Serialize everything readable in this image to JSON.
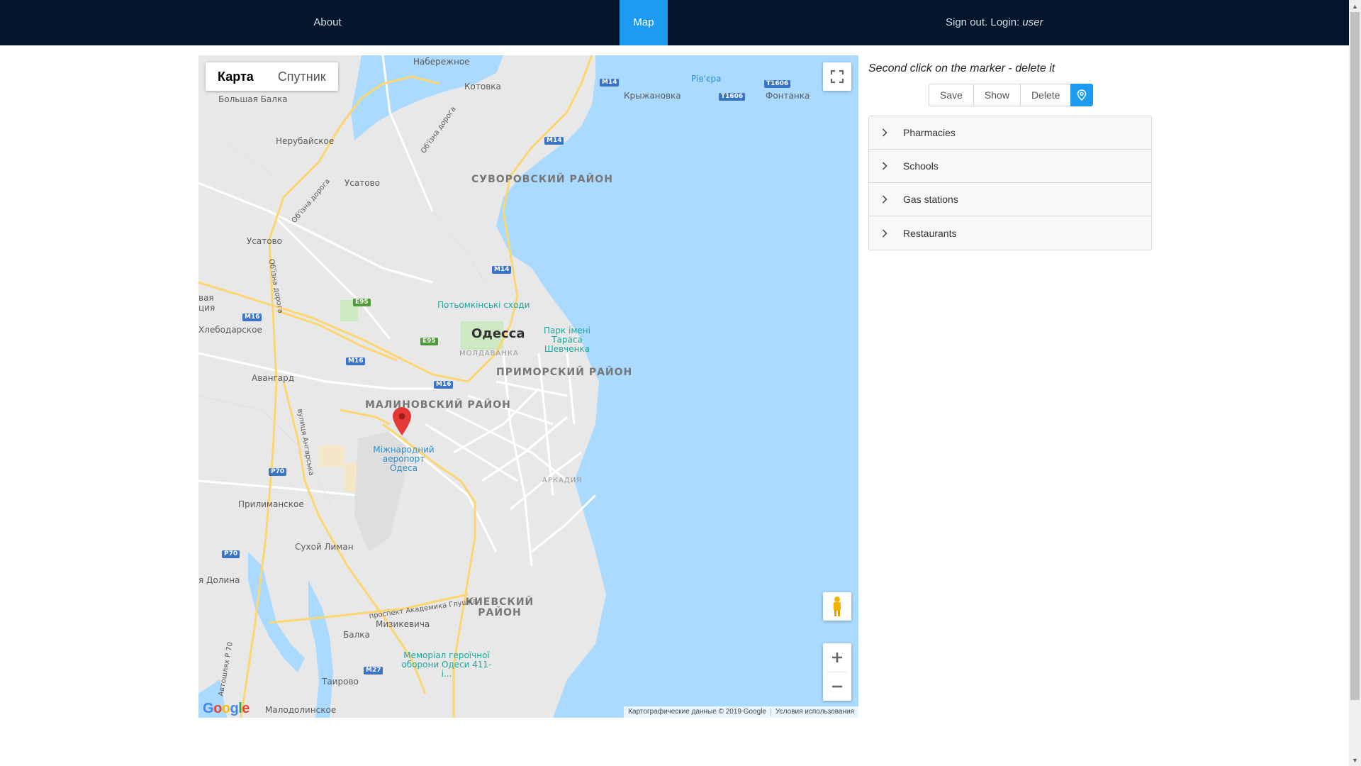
{
  "nav": {
    "about": "About",
    "map": "Map",
    "signout_prefix": "Sign out. Login:",
    "signout_user": "user"
  },
  "map": {
    "type_map": "Карта",
    "type_satellite": "Спутник",
    "attribution": "Картографические данные © 2019 Google",
    "terms": "Условия использования",
    "logo": "Google",
    "labels": {
      "naberezhnoe": "Набережное",
      "kotovka": "Котовка",
      "bolshaya_balka": "Большая Балка",
      "nerubayskoe": "Нерубайское",
      "usatovo1": "Усатово",
      "usatovo2": "Усатово",
      "suvorovsky": "СУВОРОВСКИЙ РАЙОН",
      "riviera": "Рів'єра",
      "kryzhanovka": "Крыжановка",
      "fontanka": "Фонтанка",
      "potemkin": "Потьомкінські сходи",
      "odessa": "Одесса",
      "moldavanka": "МОЛДАВАНКА",
      "park": "Парк імені Тараса Шевченка",
      "primorsky": "ПРИМОРСКИЙ РАЙОН",
      "malinovsky": "МАЛИНОВСКИЙ РАЙОН",
      "airport": "Міжнародний аеропорт Одеса",
      "arkadia": "АРКАДИЯ",
      "khlebodarskoe": "Хлебодарское",
      "vaya_tsiya": "вая ция",
      "avangard": "Авангард",
      "prilimanskoe": "Прилиманское",
      "sukhoy_liman": "Сухой Лиман",
      "ya_dolina": "я Долина",
      "kievsky": "КИЕВСКИЙ РАЙОН",
      "muzykevicha": "Мизикевича",
      "balka": "Балка",
      "memorial": "Меморіал героїчної оборони Одеси 411-і...",
      "tairovo": "Таирово",
      "malodolinskoe": "Малодолинское",
      "prospekt_glushka": "проспект Академика Глушка",
      "angarskaya": "вулиця Ангарська",
      "obizna1": "Об'їзна дорога",
      "obizna2": "Об'їзна дорога",
      "obizna3": "Об'їзна дорога",
      "avtoshlyakh": "Автошлях Р 70"
    },
    "shields": {
      "m14a": "M14",
      "m14b": "M14",
      "m14c": "M14",
      "t1606a": "T1606",
      "t1606b": "T1606",
      "e95a": "E95",
      "e95b": "E95",
      "m16a": "M16",
      "m16b": "M16",
      "m16c": "M16",
      "p70a": "P70",
      "p70b": "P70",
      "m27": "M27"
    },
    "colors": {
      "water": "#aadaff",
      "land": "#e8e8e8",
      "road_major": "#fcd670",
      "marker": "#e53935"
    }
  },
  "panel": {
    "hint": "Second click on the marker - delete it",
    "buttons": {
      "save": "Save",
      "show": "Show",
      "delete": "Delete",
      "locate_icon": "map-pin-icon"
    },
    "categories": [
      "Pharmacies",
      "Schools",
      "Gas stations",
      "Restaurants"
    ]
  },
  "theme": {
    "navbar_bg": "#03152b",
    "active_tab": "#1d9bf0"
  }
}
